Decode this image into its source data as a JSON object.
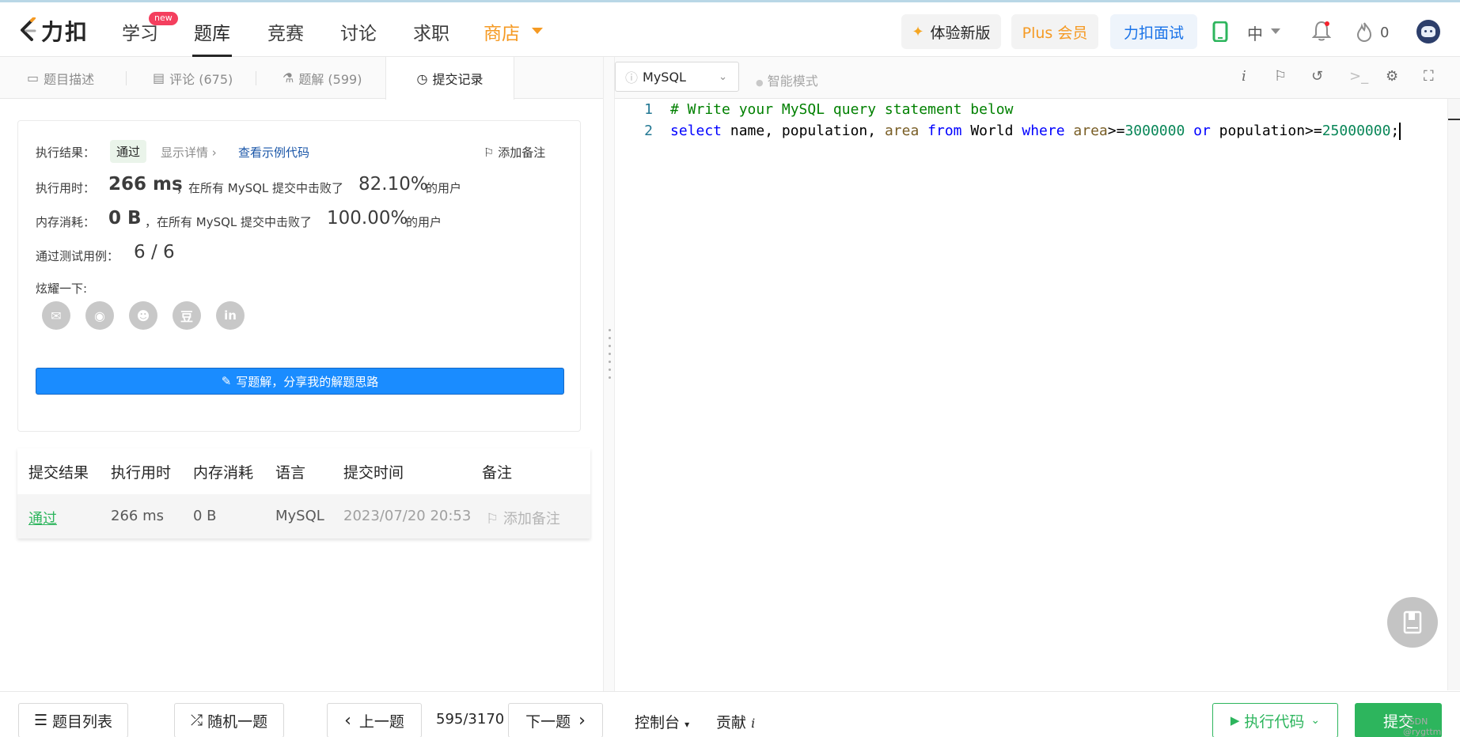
{
  "nav": {
    "logo_text": "力扣",
    "items": [
      "学习",
      "题库",
      "竞赛",
      "讨论",
      "求职",
      "商店"
    ],
    "new_badge": "new",
    "active_item": "题库",
    "btn_new_ui": "体验新版",
    "btn_plus": "Plus 会员",
    "btn_interview": "力扣面试",
    "lang": "中",
    "points": "0"
  },
  "tabs": {
    "description": "题目描述",
    "comments": "评论 (675)",
    "solutions": "题解 (599)",
    "submissions": "提交记录"
  },
  "result": {
    "exec_result_label": "执行结果：",
    "status": "通过",
    "show_detail": "显示详情 ›",
    "view_sample": "查看示例代码",
    "add_note": "添加备注",
    "runtime_label": "执行用时：",
    "runtime_value": "266 ms",
    "runtime_mid": "，在所有 MySQL 提交中击败了",
    "runtime_pct": "82.10%",
    "runtime_tail": "的用户",
    "memory_label": "内存消耗：",
    "memory_value": "0 B",
    "memory_mid": "，在所有 MySQL 提交中击败了",
    "memory_pct": "100.00%",
    "memory_tail": "的用户",
    "tests_label": "通过测试用例：",
    "tests_value": "6 / 6",
    "share_label": "炫耀一下:",
    "share_icons": [
      "wechat-icon",
      "weibo-icon",
      "qq-icon",
      "douban-icon",
      "linkedin-icon"
    ],
    "write_solution": "写题解，分享我的解题思路"
  },
  "submissions": {
    "headers": [
      "提交结果",
      "执行用时",
      "内存消耗",
      "语言",
      "提交时间",
      "备注"
    ],
    "rows": [
      {
        "status": "通过",
        "runtime": "266 ms",
        "memory": "0 B",
        "lang": "MySQL",
        "time": "2023/07/20 20:53",
        "note": "添加备注"
      }
    ]
  },
  "editor": {
    "language": "MySQL",
    "smart_mode": "智能模式",
    "line_numbers": [
      "1",
      "2"
    ],
    "line1": "# Write your MySQL query statement below",
    "line2_tokens": [
      {
        "t": "select",
        "c": "kw"
      },
      {
        "t": " name, population, ",
        "c": "plain"
      },
      {
        "t": "area",
        "c": "fn"
      },
      {
        "t": " ",
        "c": "plain"
      },
      {
        "t": "from",
        "c": "kw"
      },
      {
        "t": " World ",
        "c": "plain"
      },
      {
        "t": "where",
        "c": "kw"
      },
      {
        "t": " ",
        "c": "plain"
      },
      {
        "t": "area",
        "c": "fn"
      },
      {
        "t": ">=",
        "c": "plain"
      },
      {
        "t": "3000000",
        "c": "num"
      },
      {
        "t": " ",
        "c": "plain"
      },
      {
        "t": "or",
        "c": "kw"
      },
      {
        "t": " population>=",
        "c": "plain"
      },
      {
        "t": "25000000",
        "c": "num"
      },
      {
        "t": ";",
        "c": "plain"
      }
    ]
  },
  "bottom": {
    "problem_list": "题目列表",
    "random": "随机一题",
    "prev": "上一题",
    "progress": "595/3170",
    "next": "下一题",
    "console": "控制台",
    "contribute": "贡献",
    "run": "执行代码",
    "submit": "提交",
    "watermark": "CSDN @rygttm"
  },
  "colors": {
    "accent_blue": "#1a8cff",
    "success_green": "#2db55d",
    "shop_orange": "#f59a23"
  }
}
